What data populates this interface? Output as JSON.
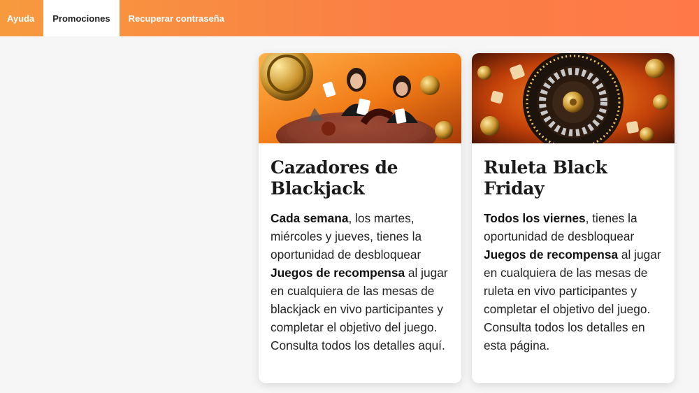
{
  "nav": {
    "items": [
      {
        "label": "Ayuda"
      },
      {
        "label": "Promociones"
      },
      {
        "label": "Recuperar contraseña"
      }
    ],
    "active_index": 1
  },
  "promotions": [
    {
      "title": "Cazadores de Blackjack",
      "desc_bold_1": "Cada semana",
      "desc_text_1": ", los martes, miércoles y jueves, tienes la oportunidad de desbloquear ",
      "desc_bold_2": "Juegos de recompensa",
      "desc_text_2": " al jugar en cualquiera de las mesas de blackjack en vivo participantes y completar el objetivo del juego. Consulta todos los detalles aquí."
    },
    {
      "title": "Ruleta Black Friday",
      "desc_bold_1": "Todos los viernes",
      "desc_text_1": ", tienes la oportunidad de desbloquear ",
      "desc_bold_2": "Juegos de recompensa",
      "desc_text_2": " al jugar en cualquiera de las mesas de ruleta en vivo participantes y completar el objetivo del juego. Consulta todos los detalles en esta página."
    }
  ],
  "colors": {
    "nav_gradient_start": "#f79a3e",
    "nav_gradient_end": "#ff7948",
    "banner_stripe": "#6b3fb3"
  }
}
